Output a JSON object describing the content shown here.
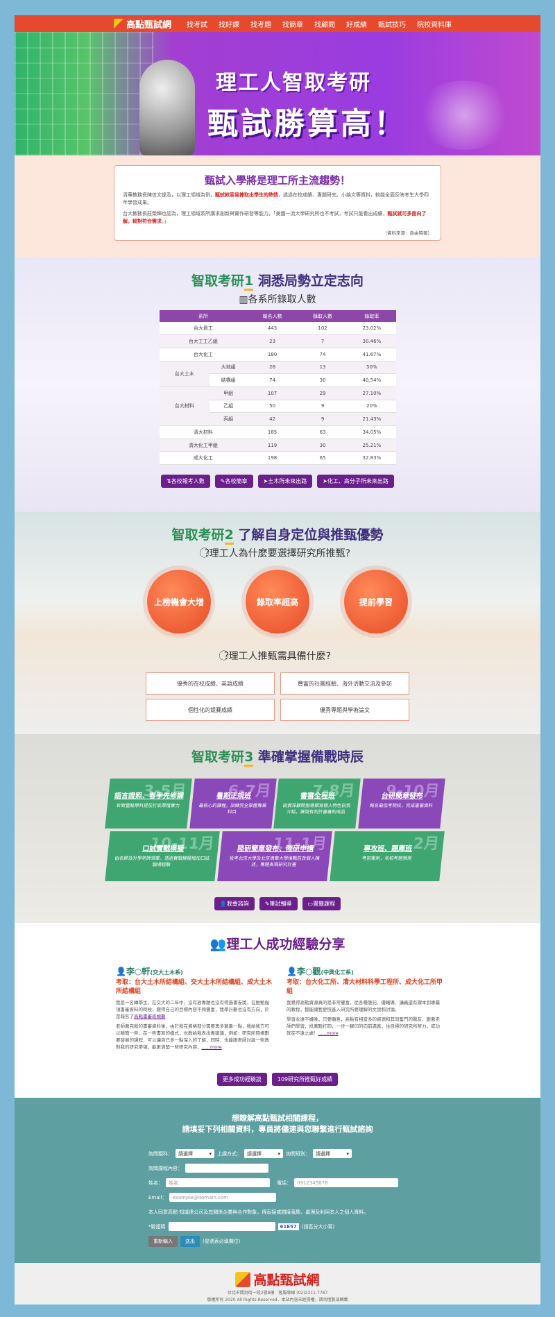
{
  "nav": {
    "brand": "高點甄試網",
    "items": [
      "找考試",
      "找好課",
      "找考題",
      "找簡章",
      "找顧問",
      "好成績",
      "甄試技巧",
      "院校資料庫"
    ]
  },
  "hero": {
    "line1": "理工人智取考研",
    "line2": "甄試勝算高！"
  },
  "intro": {
    "title": "甄試入學將是理工所主流趨勢！",
    "p1_a": "清華教務長陳信文提及，以理工領域為例，",
    "p1_red": "甄試較容易揀取出學生的熱情",
    "p1_b": "，透過在校成績、專題研究、小論文等資料，較能全面反映考生大學四年學習成果。",
    "p2_a": "台大教務長莊榮輝也認為，理工領域系所講求創新與實作研發等能力，「美國一流大學研究所也不考試，考試只能看出成績，",
    "p2_red": "甄試就可多面向了解，較對符合需求",
    "p2_b": "。」",
    "source": "（資料來源：自由時報）"
  },
  "sec1": {
    "prefix": "智取考研",
    "num": "1",
    "title": "洞悉局勢立定志向",
    "subtitle": "各系所錄取人數",
    "table_headers": [
      "系所",
      "報名人數",
      "錄取人數",
      "錄取率"
    ],
    "rows": [
      {
        "dept": "台大資工",
        "sub": "",
        "apply": "443",
        "admit": "102",
        "rate": "23.02%"
      },
      {
        "dept": "台大工工乙組",
        "sub": "",
        "apply": "23",
        "admit": "7",
        "rate": "30.46%"
      },
      {
        "dept": "台大化工",
        "sub": "",
        "apply": "180",
        "admit": "74",
        "rate": "41.67%"
      },
      {
        "dept": "台大土木",
        "sub": "大地組",
        "apply": "26",
        "admit": "13",
        "rate": "50%"
      },
      {
        "dept": "",
        "sub": "結構組",
        "apply": "74",
        "admit": "30",
        "rate": "40.54%"
      },
      {
        "dept": "台大材料",
        "sub": "甲組",
        "apply": "107",
        "admit": "29",
        "rate": "27.10%"
      },
      {
        "dept": "",
        "sub": "乙組",
        "apply": "50",
        "admit": "9",
        "rate": "20%"
      },
      {
        "dept": "",
        "sub": "丙組",
        "apply": "42",
        "admit": "9",
        "rate": "21.43%"
      },
      {
        "dept": "清大材料",
        "sub": "",
        "apply": "185",
        "admit": "63",
        "rate": "34.05%"
      },
      {
        "dept": "清大化工甲組",
        "sub": "",
        "apply": "119",
        "admit": "30",
        "rate": "25.21%"
      },
      {
        "dept": "成大化工",
        "sub": "",
        "apply": "198",
        "admit": "65",
        "rate": "32.83%"
      }
    ],
    "buttons": [
      "各校報考人數",
      "各校簡章",
      "土木所未來出路",
      "化工、高分子所未來出路"
    ]
  },
  "sec2": {
    "prefix": "智取考研",
    "num": "2",
    "title": "了解自身定位與推甄優勢",
    "q1": "理工人為什麼要選擇研究所推甄?",
    "circles": [
      "上榜機會大增",
      "錄取率超高",
      "提前學習"
    ],
    "q2": "理工人推甄需具備什麼?",
    "needs": [
      "優秀的在校成績、英語成績",
      "豐富的社團經驗、海外活動交流及參訪",
      "個性化的競賽成績",
      "優秀專題與學術論文"
    ]
  },
  "sec3": {
    "prefix": "智取考研",
    "num": "3",
    "title": "準確掌握備戰時辰",
    "row1": [
      {
        "time": "3-5月",
        "title": "語言證照、春季先修課",
        "desc": "針對重點學科提前打底厚植實力"
      },
      {
        "time": "6-7月",
        "title": "暑期正規班",
        "desc": "最核心的課程，訓練完全掌握專業科目"
      },
      {
        "time": "7-8月",
        "title": "書審全程班",
        "desc": "由資深顧問指導撰寫個人特色自我介紹，展現有利於書審的成品"
      },
      {
        "time": "9-10月",
        "title": "台研簡章發布",
        "desc": "報名最佳考院校，完成書審資料"
      }
    ],
    "row2": [
      {
        "time": "10-11月",
        "title": "口試實戰模擬",
        "desc": "由名師及升學老師領軍，透過實戰模擬增加口試臨場經驗"
      },
      {
        "time": "11-1月",
        "title": "陸研簡章發布、陸研申請",
        "desc": "投考北京大學及北京清華大學推甄前改個人陳述，專題表現研究計畫"
      },
      {
        "time": "2月",
        "title": "專攻班、題庫班",
        "desc": "考前衝刺，名校考題預測"
      }
    ],
    "buttons": [
      "我要諮詢",
      "筆試輔導",
      "書籤課程"
    ]
  },
  "succ": {
    "title": "理工人成功經驗分享",
    "cases": [
      {
        "name": "李○軒",
        "school": "(交大土木系)",
        "admit": "考取：台大土木所結構組、交大土木所結構組、成大土木所結構組",
        "p1": "我是一名轉學生，在交大的二年中，沒有放專題也沒有得過書卷獎，在推甄幾項書審資料的時候，變得自己的目標內容不夠豐富，我學計劃也沒有方向，於是報名了",
        "link": "高點書審班規劃",
        "p2": "老師著完我的書審資料後，由於我在資格部分需要再多著墨一點，我給我方可以精簡一些，在一些書寫的模式，也教給我表出專建議，例如：研究所時規劃要發展的課程，可以讓自己多一點深入的了解，同時，也能跟老師討論一些教對我的研究帶領，能更清楚一些研究內容，",
        "more": "......more"
      },
      {
        "name": "李○觀",
        "school": "(中興化工系)",
        "admit": "考取：台大化工所、清大材料科學工程所、成大化工所甲組",
        "p1": "我覺得高點資源真的是非常豐富，從各種筆記、優輔導、講義還有課本到專屬的教程，都能讓我更快進入研究所要理解的文說和討論。",
        "p2": "學習永遠不嫌晚，只要願意，高點有相當多的資源和其同奮鬥的戰友，跟著老師們學習，找著聽打四，一步一腳印的向前邁進，往目標的研究所努力，成功就在不遠之處！",
        "more": "......more"
      }
    ],
    "buttons": [
      "更多成功經驗談",
      "109研究所推甄好成績"
    ]
  },
  "form": {
    "h1": "想瞭解高點甄試相關課程，",
    "h2": "請填妥下列相關資料，專員將儘速與您聯繫進行甄試諮詢",
    "l_course": "詢問類科：",
    "l_method": "上課方式：",
    "l_class": "詢問班別：",
    "select": "請選擇",
    "l_content": "詢問課程內容：",
    "l_name": "姓名：",
    "ph_name": "姓名",
    "l_phone": "電話：",
    "ph_phone": "0912345678",
    "l_email": "Email：",
    "ph_email": "example@domain.com",
    "agree": "本人同意高點·知識達公司及其關係企業與合作對象，得直接或間接蒐集、處理及利用本人之個人資料。",
    "l_code": "*驗證碼",
    "captcha": "61E57",
    "case_hint": "(請區分大小寫)",
    "reset": "重新輸入",
    "submit": "送出",
    "required": "(星號表必填欄位)"
  },
  "footer": {
    "brand": "高點甄試網",
    "addr": "台北市開封街一段2號8樓　客服專線 (02)2311-7787",
    "copy": "版權所有 2020 All Rights Reserved．本站內容未經授權，請勿擅製或轉載"
  }
}
